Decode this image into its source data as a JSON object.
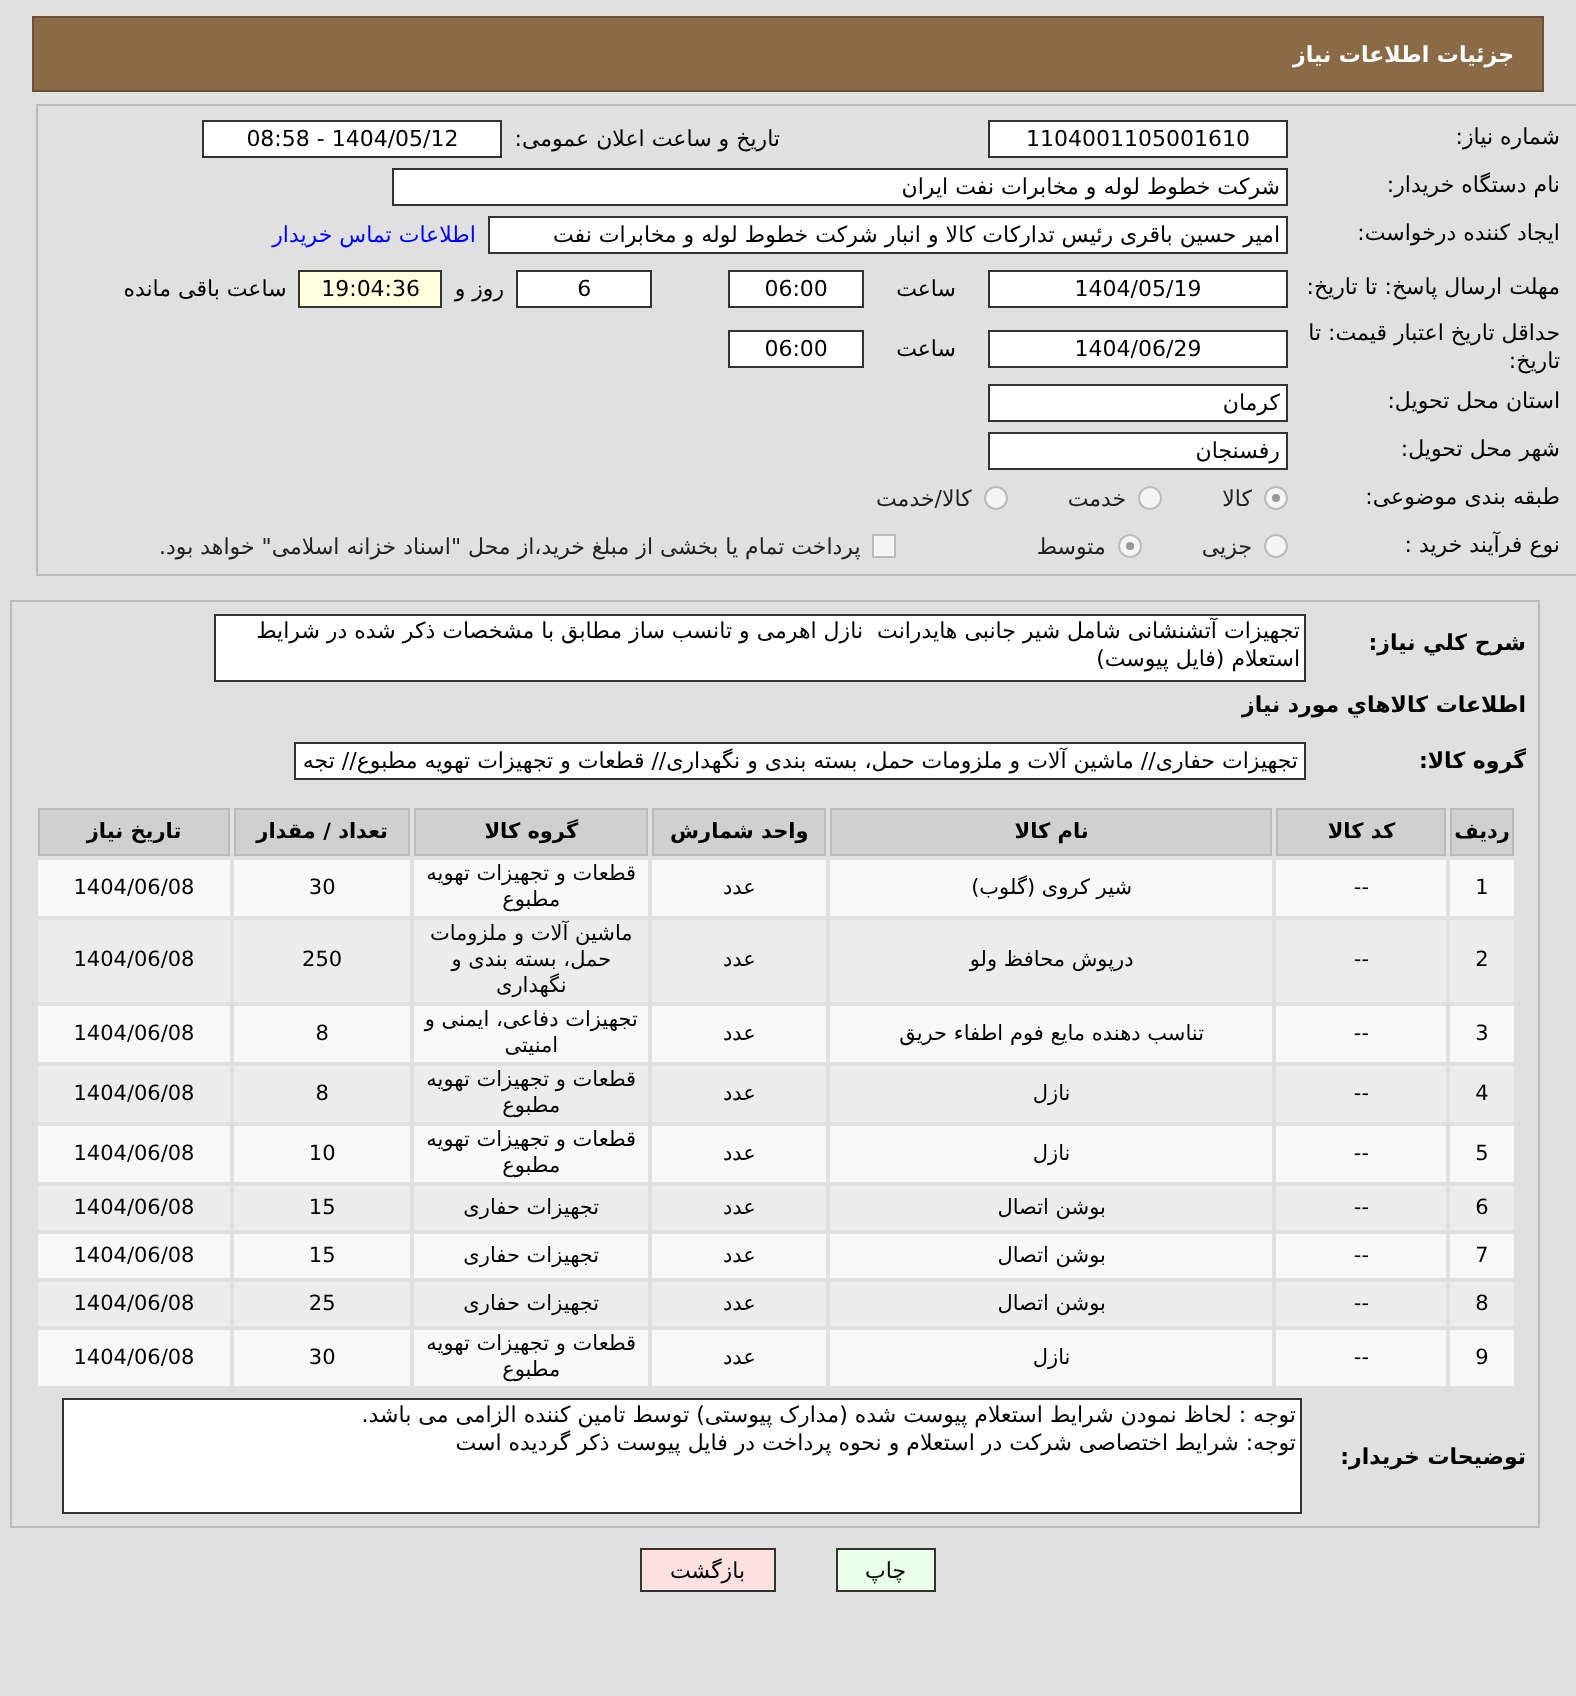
{
  "header": {
    "title": "جزئیات اطلاعات نیاز"
  },
  "need_number": {
    "label": "شماره نیاز:",
    "value": "1104001105001610"
  },
  "announce": {
    "label": "تاریخ و ساعت اعلان عمومی:",
    "value": "1404/05/12 - 08:58"
  },
  "buyer_org": {
    "label": "نام دستگاه خریدار:",
    "value": "شرکت خطوط لوله و مخابرات نفت ایران"
  },
  "requester": {
    "label": "ایجاد کننده درخواست:",
    "value": "امیر حسین  باقری  رئیس تدارکات کالا و انبار  شرکت خطوط لوله و مخابرات نفت",
    "link": "اطلاعات تماس خریدار"
  },
  "reply_deadline": {
    "label": "مهلت ارسال پاسخ: تا تاریخ:",
    "date": "1404/05/19",
    "time_label": "ساعت",
    "time": "06:00",
    "days": "6",
    "days_label": "روز و",
    "remaining": "19:04:36",
    "remaining_label": "ساعت باقی مانده"
  },
  "price_validity": {
    "label": "حداقل تاریخ اعتبار قیمت: تا تاریخ:",
    "date": "1404/06/29",
    "time_label": "ساعت",
    "time": "06:00"
  },
  "province": {
    "label": "استان محل تحویل:",
    "value": "کرمان"
  },
  "city": {
    "label": "شهر محل تحویل:",
    "value": "رفسنجان"
  },
  "category": {
    "label": "طبقه بندی موضوعی:",
    "options": [
      {
        "label": "کالا",
        "selected": true
      },
      {
        "label": "خدمت",
        "selected": false
      },
      {
        "label": "کالا/خدمت",
        "selected": false
      }
    ]
  },
  "process": {
    "label": "نوع فرآیند خرید :",
    "options": [
      {
        "label": "جزیی",
        "selected": false
      },
      {
        "label": "متوسط",
        "selected": true
      }
    ],
    "payment": {
      "checked": false,
      "text": "پرداخت تمام یا بخشی از مبلغ خرید،از محل \"اسناد خزانه اسلامی\" خواهد بود."
    }
  },
  "description": {
    "label": "شرح كلي نياز:",
    "value": "تجهیزات آتشنشانی شامل شیر جانبی هایدرانت  نازل اهرمی و تانسب ساز مطابق با مشخصات ذکر شده در شرایط استعلام (فایل پیوست)"
  },
  "goods_heading": "اطلاعات كالاهاي مورد نياز",
  "goods_group": {
    "label": "گروه کالا:",
    "value": "تجهیزات حفاری// ماشین آلات و ملزومات حمل، بسته بندی و نگهداری//  قطعات و تجهیزات تهویه مطبوع// تجه"
  },
  "table": {
    "columns": [
      "ردیف",
      "کد کالا",
      "نام کالا",
      "واحد شمارش",
      "گروه کالا",
      "تعداد / مقدار",
      "تاریخ نیاز"
    ],
    "rows": [
      [
        "1",
        "--",
        "شیر کروی (گلوب)",
        "عدد",
        "قطعات و تجهیزات تهویه مطبوع",
        "30",
        "1404/06/08"
      ],
      [
        "2",
        "--",
        "درپوش محافظ ولو",
        "عدد",
        "ماشین آلات و ملزومات حمل، بسته بندی و نگهداری",
        "250",
        "1404/06/08"
      ],
      [
        "3",
        "--",
        "تناسب دهنده مایع فوم اطفاء حریق",
        "عدد",
        "تجهیزات دفاعی، ایمنی و امنیتی",
        "8",
        "1404/06/08"
      ],
      [
        "4",
        "--",
        "نازل",
        "عدد",
        "قطعات و تجهیزات تهویه مطبوع",
        "8",
        "1404/06/08"
      ],
      [
        "5",
        "--",
        "نازل",
        "عدد",
        "قطعات و تجهیزات تهویه مطبوع",
        "10",
        "1404/06/08"
      ],
      [
        "6",
        "--",
        "بوشن اتصال",
        "عدد",
        "تجهیزات حفاری",
        "15",
        "1404/06/08"
      ],
      [
        "7",
        "--",
        "بوشن اتصال",
        "عدد",
        "تجهیزات حفاری",
        "15",
        "1404/06/08"
      ],
      [
        "8",
        "--",
        "بوشن اتصال",
        "عدد",
        "تجهیزات حفاری",
        "25",
        "1404/06/08"
      ],
      [
        "9",
        "--",
        "نازل",
        "عدد",
        "قطعات و تجهیزات تهویه مطبوع",
        "30",
        "1404/06/08"
      ]
    ]
  },
  "buyer_notes": {
    "label": "توضیحات خریدار:",
    "lines": [
      "توجه : لحاظ نمودن شرایط استعلام پیوست شده (مدارک پیوستی) توسط تامین کننده الزامی می باشد.",
      "توجه: شرایط اختصاصی شرکت در استعلام و نحوه پرداخت در فایل پیوست ذکر گردیده است"
    ]
  },
  "buttons": [
    {
      "label": "چاپ",
      "kind": "print"
    },
    {
      "label": "بازگشت",
      "kind": "back"
    }
  ]
}
